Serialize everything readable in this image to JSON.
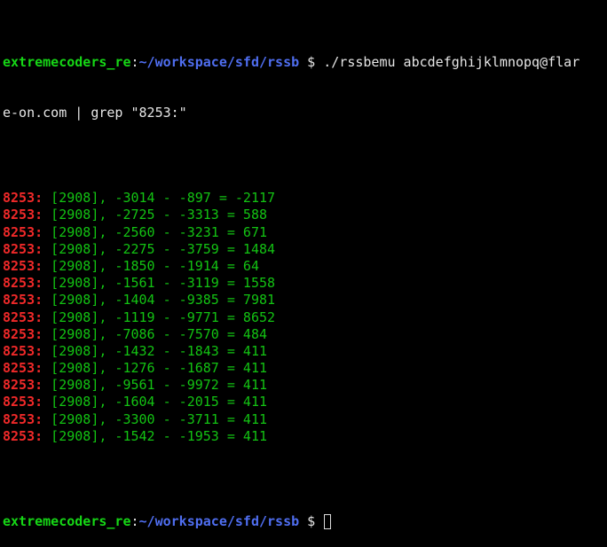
{
  "colors": {
    "background": "#000000",
    "prompt_user": "#16d716",
    "prompt_path": "#4f6ef0",
    "command_text": "#e6e6e6",
    "grep_match": "#ef2929",
    "output_text": "#13c313"
  },
  "prompt": {
    "user": "extremecoders_re",
    "separator": ":",
    "path": "~/workspace/sfd/rssb",
    "symbol": " $ "
  },
  "command": {
    "line1": "./rssbemu abcdefghijklmnopq@flar",
    "line2": "e-on.com | grep \"8253:\""
  },
  "output": [
    {
      "match": "8253:",
      "text": " [2908], -3014 - -897 = -2117"
    },
    {
      "match": "8253:",
      "text": " [2908], -2725 - -3313 = 588"
    },
    {
      "match": "8253:",
      "text": " [2908], -2560 - -3231 = 671"
    },
    {
      "match": "8253:",
      "text": " [2908], -2275 - -3759 = 1484"
    },
    {
      "match": "8253:",
      "text": " [2908], -1850 - -1914 = 64"
    },
    {
      "match": "8253:",
      "text": " [2908], -1561 - -3119 = 1558"
    },
    {
      "match": "8253:",
      "text": " [2908], -1404 - -9385 = 7981"
    },
    {
      "match": "8253:",
      "text": " [2908], -1119 - -9771 = 8652"
    },
    {
      "match": "8253:",
      "text": " [2908], -7086 - -7570 = 484"
    },
    {
      "match": "8253:",
      "text": " [2908], -1432 - -1843 = 411"
    },
    {
      "match": "8253:",
      "text": " [2908], -1276 - -1687 = 411"
    },
    {
      "match": "8253:",
      "text": " [2908], -9561 - -9972 = 411"
    },
    {
      "match": "8253:",
      "text": " [2908], -1604 - -2015 = 411"
    },
    {
      "match": "8253:",
      "text": " [2908], -3300 - -3711 = 411"
    },
    {
      "match": "8253:",
      "text": " [2908], -1542 - -1953 = 411"
    }
  ]
}
